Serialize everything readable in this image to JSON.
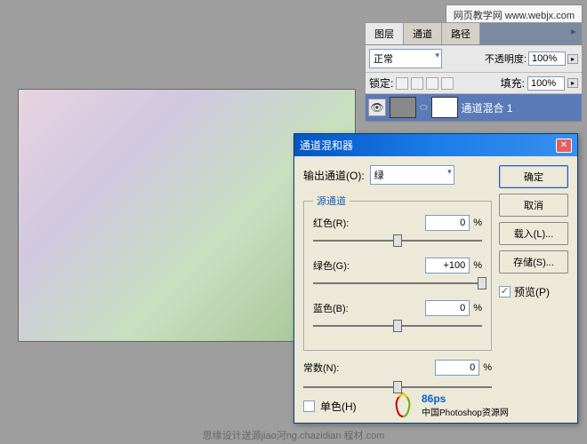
{
  "watermark": "网页教学网\nwww.webjx.com",
  "layers_panel": {
    "tabs": [
      "图层",
      "通道",
      "路径"
    ],
    "blend_mode": "正常",
    "opacity_label": "不透明度:",
    "opacity_value": "100%",
    "lock_label": "锁定:",
    "fill_label": "填充:",
    "fill_value": "100%",
    "layer_name": "通道混合 1"
  },
  "dialog": {
    "title": "通道混和器",
    "output_label": "输出通道(O):",
    "output_value": "绿",
    "source_legend": "源通道",
    "sliders": {
      "red": {
        "label": "红色(R):",
        "value": "0",
        "pos": 50
      },
      "green": {
        "label": "绿色(G):",
        "value": "+100",
        "pos": 100
      },
      "blue": {
        "label": "蓝色(B):",
        "value": "0",
        "pos": 50
      }
    },
    "constant_label": "常数(N):",
    "constant_value": "0",
    "constant_pos": 50,
    "mono_label": "单色(H)",
    "buttons": {
      "ok": "确定",
      "cancel": "取消",
      "load": "载入(L)...",
      "save": "存储(S)..."
    },
    "preview_label": "预览(P)"
  },
  "logo": {
    "brand": "86ps",
    "tagline": "中国Photoshop资源网"
  },
  "footer": "思缘设计送源jiao河ng.chazidian 程材.com",
  "chart_data": {
    "type": "table",
    "title": "通道混和器 (Channel Mixer)",
    "output_channel": "绿",
    "series": [
      {
        "name": "红色",
        "value": 0,
        "unit": "%"
      },
      {
        "name": "绿色",
        "value": 100,
        "unit": "%"
      },
      {
        "name": "蓝色",
        "value": 0,
        "unit": "%"
      },
      {
        "name": "常数",
        "value": 0,
        "unit": "%"
      }
    ],
    "monochrome": false,
    "preview": true
  }
}
